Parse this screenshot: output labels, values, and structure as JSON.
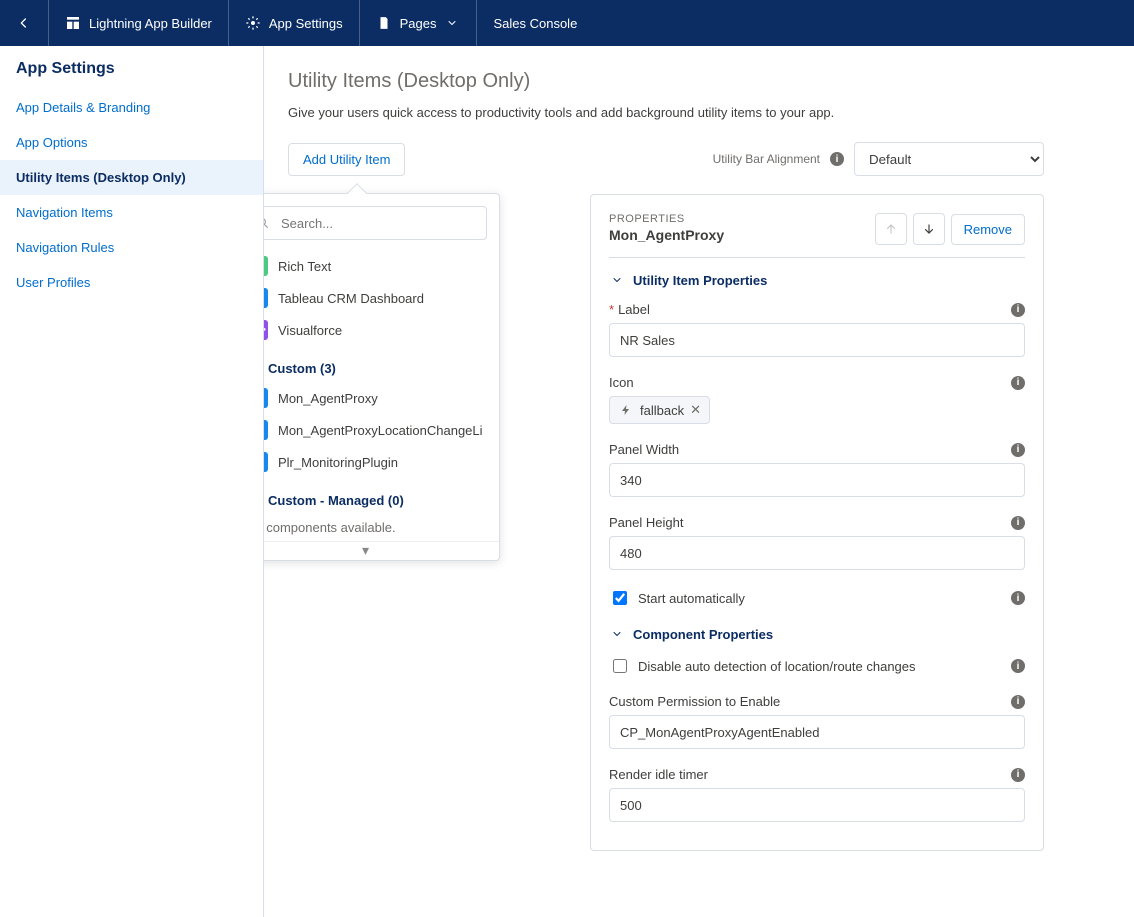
{
  "topbar": {
    "back": "Back",
    "builder": "Lightning App Builder",
    "settings": "App Settings",
    "pages": "Pages",
    "app_name": "Sales Console"
  },
  "sidebar": {
    "heading": "App Settings",
    "items": [
      {
        "label": "App Details & Branding"
      },
      {
        "label": "App Options"
      },
      {
        "label": "Utility Items (Desktop Only)"
      },
      {
        "label": "Navigation Items"
      },
      {
        "label": "Navigation Rules"
      },
      {
        "label": "User Profiles"
      }
    ]
  },
  "page": {
    "title": "Utility Items (Desktop Only)",
    "subtitle": "Give your users quick access to productivity tools and add background utility items to your app.",
    "add_btn": "Add Utility Item",
    "align_label": "Utility Bar Alignment",
    "align_value": "Default"
  },
  "popover": {
    "search_ph": "Search...",
    "std_items": [
      {
        "label": "Rich Text",
        "icon": "rich",
        "color": "ci-green"
      },
      {
        "label": "Tableau CRM Dashboard",
        "icon": "chart",
        "color": "ci-blue"
      },
      {
        "label": "Visualforce",
        "icon": "code",
        "color": "ci-purple"
      }
    ],
    "custom_h": "Custom (3)",
    "custom_items": [
      {
        "label": "Mon_AgentProxy"
      },
      {
        "label": "Mon_AgentProxyLocationChangeLi"
      },
      {
        "label": "Plr_MonitoringPlugin"
      }
    ],
    "managed_h": "Custom - Managed (0)",
    "managed_empty": "No components available.",
    "footer": "▾"
  },
  "props": {
    "header_kicker": "PROPERTIES",
    "header_name": "Mon_AgentProxy",
    "remove": "Remove",
    "sec1": "Utility Item Properties",
    "label_lbl": "Label",
    "label_val": "NR Sales",
    "icon_lbl": "Icon",
    "icon_val": "fallback",
    "pw_lbl": "Panel Width",
    "pw_val": "340",
    "ph_lbl": "Panel Height",
    "ph_val": "480",
    "start_auto": "Start automatically",
    "start_auto_checked": true,
    "sec2": "Component Properties",
    "disable_auto": "Disable auto detection of location/route changes",
    "disable_auto_checked": false,
    "cust_perm_lbl": "Custom Permission to Enable",
    "cust_perm_val": "CP_MonAgentProxyAgentEnabled",
    "idle_lbl": "Render idle timer",
    "idle_val": "500"
  }
}
